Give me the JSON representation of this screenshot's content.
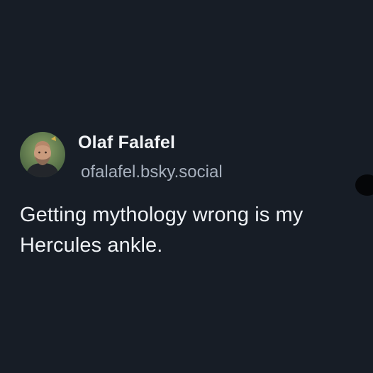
{
  "post": {
    "author": {
      "display_name": "Olaf Falafel",
      "handle": "ofalafel.bsky.social",
      "avatar_icon": "profile-photo"
    },
    "text_lines": [
      "Getting mythology wrong is my",
      "Hercules ankle."
    ]
  },
  "colors": {
    "background": "#171d26",
    "name_text": "#f2f4f7",
    "handle_text": "#a7b0bd",
    "body_text": "#eef1f5"
  }
}
